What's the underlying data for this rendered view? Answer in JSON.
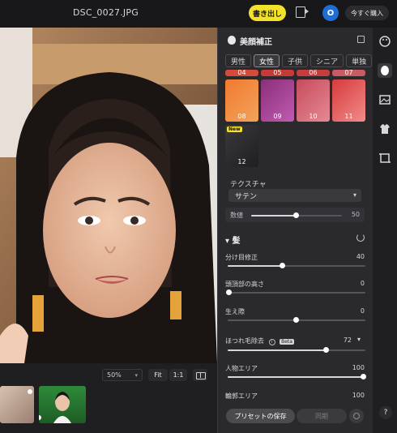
{
  "topbar": {
    "filename": "DSC_0027.JPG",
    "export_label": "書き出し",
    "avatar_initial": "O",
    "buy_label": "今すぐ購入"
  },
  "viewer": {
    "zoom_value": "50%",
    "fit_label": "Fit",
    "one_to_one_label": "1:1"
  },
  "panel": {
    "title": "美顔補正",
    "tabs": [
      {
        "label": "男性",
        "active": false
      },
      {
        "label": "女性",
        "active": true
      },
      {
        "label": "子供",
        "active": false
      },
      {
        "label": "シニア",
        "active": false
      },
      {
        "label": "単独",
        "active": false
      }
    ],
    "partial_swatches": [
      "04",
      "05",
      "06",
      "07"
    ],
    "swatches": [
      {
        "label": "08",
        "color1": "#f07a2f",
        "color2": "#f3a35b"
      },
      {
        "label": "09",
        "color1": "#8b2f78",
        "color2": "#c05bb2"
      },
      {
        "label": "10",
        "color1": "#c74b5c",
        "color2": "#e58a93"
      },
      {
        "label": "11",
        "color1": "#d73a3a",
        "color2": "#f28c8c"
      }
    ],
    "swatch_12": {
      "label": "12",
      "badge": "New"
    },
    "texture": {
      "label": "テクスチャ",
      "value": "サテン"
    },
    "amount": {
      "label": "数値",
      "value": "50",
      "level": 0.5
    },
    "hair_section": {
      "title": "髪",
      "rows": [
        {
          "label": "分け目修正",
          "value": "40",
          "level": 0.4
        },
        {
          "label": "頭頂部の高さ",
          "value": "0",
          "level": 0.0
        },
        {
          "label": "生え際",
          "value": "0",
          "level": 0.5
        },
        {
          "label": "ほつれ毛除去",
          "value": "72",
          "level": 0.72,
          "beta": "Beta"
        },
        {
          "label": "人物エリア",
          "value": "100",
          "level": 1.0
        },
        {
          "label": "輪郭エリア",
          "value": "100",
          "level": 1.0
        }
      ]
    },
    "footer": {
      "save_preset_label": "プリセットの保存",
      "sync_label": "同期"
    }
  },
  "rail": {
    "help_label": "?"
  },
  "colors": {
    "accent_yellow": "#f4e12a",
    "avatar_blue": "#1f6dd6"
  }
}
